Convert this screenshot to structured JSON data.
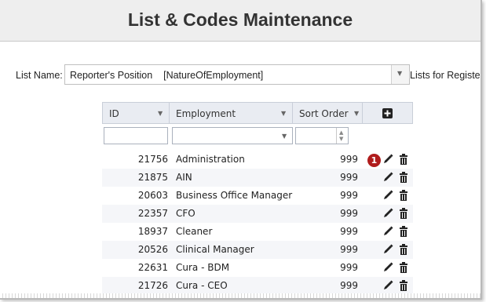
{
  "page": {
    "title": "List & Codes Maintenance"
  },
  "list_selector": {
    "label": "List Name:",
    "value": "Reporter's Position    [NatureOfEmployment]",
    "right_text": "Lists for Register"
  },
  "grid": {
    "columns": [
      {
        "label": "ID"
      },
      {
        "label": "Employment"
      },
      {
        "label": "Sort Order"
      }
    ],
    "rows": [
      {
        "id": "21756",
        "employment": "Administration",
        "sort_order": "999"
      },
      {
        "id": "21875",
        "employment": "AIN",
        "sort_order": "999"
      },
      {
        "id": "20603",
        "employment": "Business Office Manager",
        "sort_order": "999"
      },
      {
        "id": "22357",
        "employment": "CFO",
        "sort_order": "999"
      },
      {
        "id": "18937",
        "employment": "Cleaner",
        "sort_order": "999"
      },
      {
        "id": "20526",
        "employment": "Clinical Manager",
        "sort_order": "999"
      },
      {
        "id": "22631",
        "employment": "Cura - BDM",
        "sort_order": "999"
      },
      {
        "id": "21726",
        "employment": "Cura - CEO",
        "sort_order": "999"
      }
    ],
    "callout_number": "1"
  },
  "icons": {
    "filter": "pin-icon",
    "add": "plus-square-icon",
    "edit": "pencil-icon",
    "delete": "trash-icon"
  },
  "colors": {
    "header_bg": "#e9ecf2",
    "callout": "#b01c1c",
    "title_bar": "#eeeeee"
  }
}
